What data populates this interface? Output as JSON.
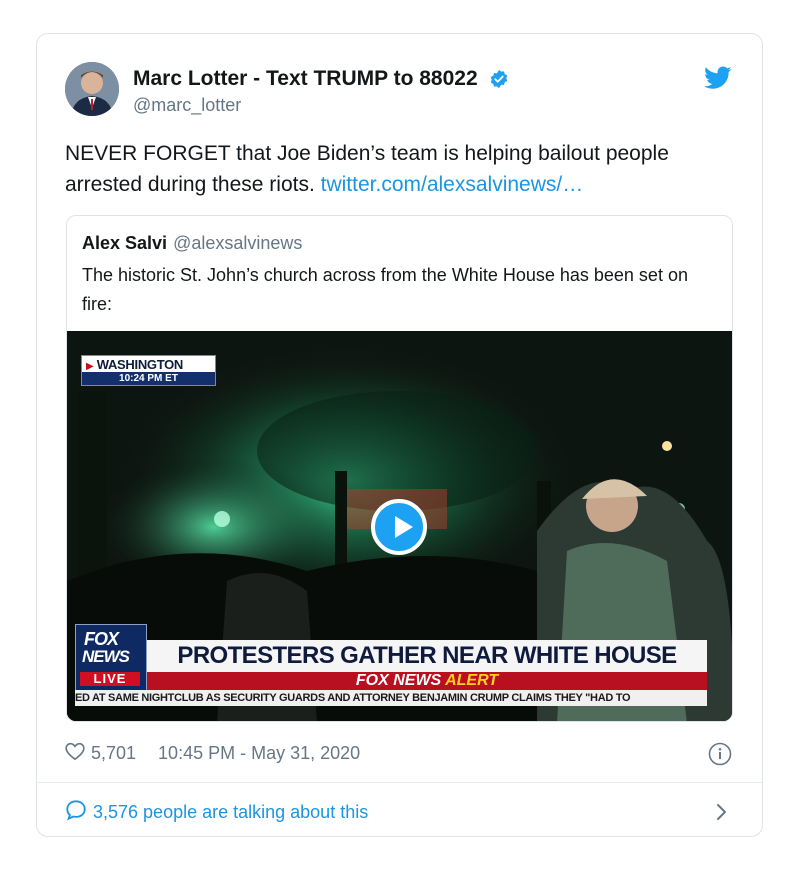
{
  "tweet": {
    "author_name": "Marc Lotter - Text TRUMP to 88022",
    "author_handle": "@marc_lotter",
    "text": "NEVER FORGET that Joe Biden’s team is helping bailout people arrested during these riots.",
    "link": "twitter.com/alexsalvinews/…",
    "likes": "5,701",
    "timestamp": "10:45 PM - May 31, 2020",
    "talking": "3,576 people are talking about this",
    "icons": [
      "verified-badge-icon",
      "twitter-bird-icon",
      "heart-icon",
      "info-icon",
      "comment-bubble-icon",
      "chevron-right-icon",
      "play-icon"
    ],
    "colors": {
      "accent": "#1da1f2",
      "link": "#1b95e0",
      "muted": "#657786"
    }
  },
  "quoted": {
    "author_name": "Alex Salvi",
    "author_handle": "@alexsalvinews",
    "text": "The historic St. John’s church across from the White House has been set on fire:",
    "video": {
      "location": "WASHINGTON",
      "time": "10:24 PM ET",
      "logo_line1": "FOX",
      "logo_line2": "NEWS",
      "live": "LIVE",
      "headline": "PROTESTERS GATHER NEAR WHITE HOUSE",
      "alert_part1": "FOX NEWS",
      "alert_part2": "ALERT",
      "ticker": "ED AT SAME NIGHTCLUB AS SECURITY GUARDS AND ATTORNEY BENJAMIN CRUMP CLAIMS THEY \"HAD TO"
    }
  }
}
